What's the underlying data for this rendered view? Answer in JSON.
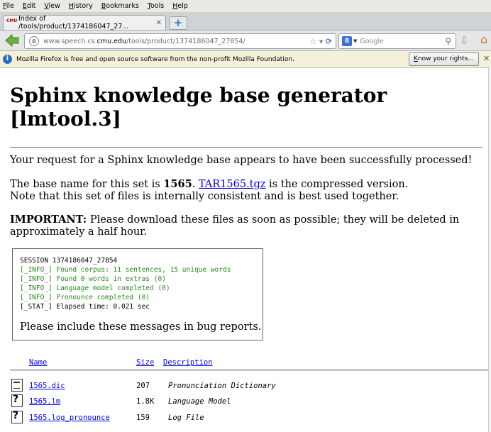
{
  "menu": [
    "File",
    "Edit",
    "View",
    "History",
    "Bookmarks",
    "Tools",
    "Help"
  ],
  "tab": {
    "favicon_text": "CMU",
    "title": "Index of /tools/product/1374186047_27..."
  },
  "url": {
    "prefix": "www.speech.cs.",
    "domain": "cmu.edu",
    "path": "/tools/product/1374186047_27854/"
  },
  "search": {
    "engine": "8",
    "placeholder": "Google"
  },
  "notification": {
    "text": "Mozilla Firefox is free and open source software from the non-profit Mozilla Foundation.",
    "button": "Know your rights..."
  },
  "page": {
    "title": "Sphinx knowledge base generator [lmtool.3]",
    "success": "Your request for a Sphinx knowledge base appears to have been successfully processed!",
    "base_pre": "The base name for this set is ",
    "base_name": "1565",
    "base_sep": ". ",
    "tar_link": "TAR1565.tgz",
    "base_post": " is the compressed version.",
    "consistency": "Note that this set of files is internally consistent and is best used together.",
    "important_label": "IMPORTANT:",
    "important_text": " Please download these files as soon as possible; they will be deleted in approximately a half hour."
  },
  "log": {
    "lines": [
      {
        "text": "SESSION 1374186047_27854",
        "color": "black"
      },
      {
        "text": "[_INFO_] Found corpus: 11 sentences, 15 unique words",
        "color": "green"
      },
      {
        "text": "[_INFO_] Found 0 words in extras  (0)",
        "color": "green"
      },
      {
        "text": "[_INFO_] Language model completed  (0)",
        "color": "green"
      },
      {
        "text": "[_INFO_] Pronounce completed  (0)",
        "color": "green"
      },
      {
        "text": "[_STAT_] Elapsed time: 0.021 sec",
        "color": "black"
      }
    ],
    "note": "Please include these messages in bug reports."
  },
  "table": {
    "headers": {
      "name": "Name",
      "size": "Size",
      "description": "Description"
    },
    "rows": [
      {
        "icon": "text-file-icon",
        "name": "1565.dic",
        "size": "207",
        "description": "Pronunciation Dictionary"
      },
      {
        "icon": "unknown-file-icon",
        "name": "1565.lm",
        "size": "1.8K",
        "description": "Language Model"
      },
      {
        "icon": "unknown-file-icon",
        "name": "1565.log_pronounce",
        "size": "159",
        "description": "Log File"
      }
    ]
  },
  "colors": {
    "link": "#0000ee",
    "log_green": "#2a8a1f",
    "notification_bg": "#f4f0d9"
  }
}
